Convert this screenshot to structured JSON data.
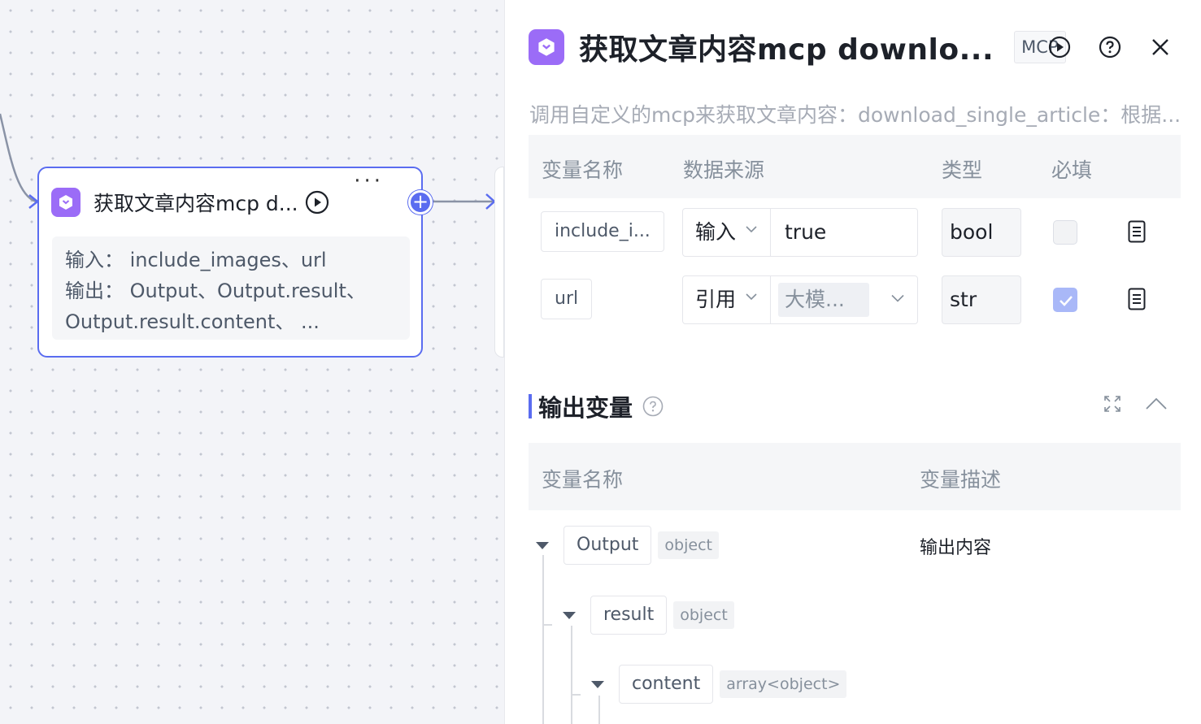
{
  "canvas": {
    "node": {
      "title": "获取文章内容mcp d...",
      "input_line": "输入：  include_images、url",
      "output_line": "输出：  Output、Output.result、",
      "output_line2": "Output.result.content、 ...",
      "more": "···"
    }
  },
  "panel": {
    "title": "获取文章内容mcp downlo...",
    "tag": "MCP",
    "description": "调用自定义的mcp来获取文章内容：download_single_article：根据...",
    "input_table": {
      "headers": [
        "变量名称",
        "数据来源",
        "类型",
        "必填"
      ],
      "rows": [
        {
          "name": "include_i...",
          "source": "输入",
          "value": "true",
          "type": "bool",
          "required": false
        },
        {
          "name": "url",
          "source": "引用",
          "value": "大模...",
          "type": "str",
          "required": true
        }
      ]
    },
    "output_section": {
      "title": "输出变量",
      "headers": [
        "变量名称",
        "变量描述"
      ],
      "tree": [
        {
          "name": "Output",
          "type": "object",
          "description": "输出内容"
        },
        {
          "name": "result",
          "type": "object"
        },
        {
          "name": "content",
          "type": "array<object>"
        }
      ]
    },
    "accent_color": "#5a6cf0",
    "icon_color": "#9b6cf7"
  }
}
